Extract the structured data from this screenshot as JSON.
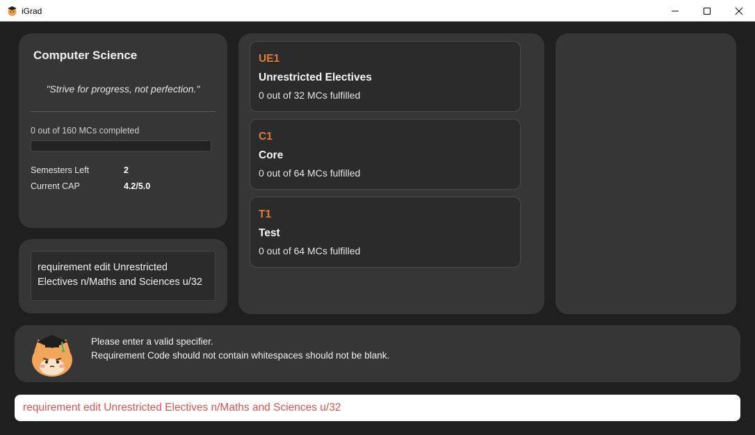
{
  "window": {
    "title": "iGrad",
    "minimize_icon": "minimize-icon",
    "maximize_icon": "maximize-icon",
    "close_icon": "close-icon"
  },
  "degree": {
    "title": "Computer Science",
    "quote": "\"Strive for progress, not perfection.\"",
    "progress_text": "0 out of 160 MCs completed",
    "progress_fraction": 0,
    "semesters_left_label": "Semesters Left",
    "semesters_left_value": "2",
    "cap_label": "Current CAP",
    "cap_value": "4.2/5.0"
  },
  "command_echo": "requirement edit Unrestricted Electives n/Maths and Sciences u/32",
  "requirements": [
    {
      "code": "UE1",
      "title": "Unrestricted Electives",
      "progress": "0 out of 32 MCs fulfilled"
    },
    {
      "code": "C1",
      "title": "Core",
      "progress": "0 out of 64 MCs fulfilled"
    },
    {
      "code": "T1",
      "title": "Test",
      "progress": "0 out of 64 MCs fulfilled"
    }
  ],
  "result": {
    "avatar_icon": "graduate-cat-icon",
    "lines": [
      "Please enter a valid specifier.",
      "Requirement Code should not contain whitespaces should not be blank."
    ]
  },
  "command_input": {
    "value": "requirement edit Unrestricted Electives n/Maths and Sciences u/32"
  },
  "colors": {
    "accent": "#e07b39",
    "error_text": "#d9534f",
    "panel": "#363636",
    "background": "#1f1f1f"
  }
}
